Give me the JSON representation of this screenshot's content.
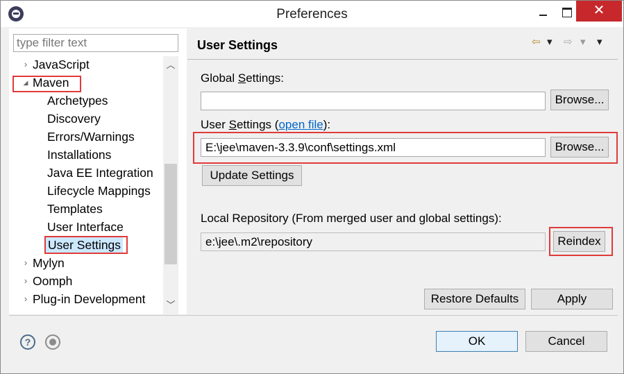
{
  "window": {
    "title": "Preferences",
    "close_glyph": "✕"
  },
  "filter": {
    "placeholder": "type filter text"
  },
  "tree": {
    "items": [
      {
        "label": "JavaScript",
        "arrow": "›"
      },
      {
        "label": "Maven",
        "arrow": "◢"
      },
      {
        "label": "Archetypes"
      },
      {
        "label": "Discovery"
      },
      {
        "label": "Errors/Warnings"
      },
      {
        "label": "Installations"
      },
      {
        "label": "Java EE Integration"
      },
      {
        "label": "Lifecycle Mappings"
      },
      {
        "label": "Templates"
      },
      {
        "label": "User Interface"
      },
      {
        "label": "User Settings"
      },
      {
        "label": "Mylyn",
        "arrow": "›"
      },
      {
        "label": "Oomph",
        "arrow": "›"
      },
      {
        "label": "Plug-in Development",
        "arrow": "›"
      }
    ],
    "scroll_up": "︿",
    "scroll_down": "﹀"
  },
  "page": {
    "title": "User Settings",
    "nav_back": "⇦",
    "nav_back_menu": "▾",
    "nav_fwd": "⇨",
    "nav_fwd_menu": "▾",
    "view_menu": "▾"
  },
  "global_settings": {
    "label_pre": "Global ",
    "label_u": "S",
    "label_post": "ettings:",
    "value": "",
    "browse": "Browse..."
  },
  "user_settings": {
    "label_pre": "User ",
    "label_u": "S",
    "label_post": "ettings (",
    "link": "open file",
    "label_end": "):",
    "value": "E:\\jee\\maven-3.3.9\\conf\\settings.xml",
    "browse": "Browse...",
    "update": "Update Settings"
  },
  "local_repo": {
    "label": "Local Repository (From merged user and global settings):",
    "value": "e:\\jee\\.m2\\repository",
    "reindex": "Reindex"
  },
  "buttons": {
    "restore": "Restore Defaults",
    "apply": "Apply",
    "ok": "OK",
    "cancel": "Cancel"
  },
  "footer": {
    "help": "?"
  },
  "colors": {
    "annotation_red": "#e03a3a",
    "selection": "#cce8ff",
    "link": "#0066cc",
    "close_button": "#c7282c"
  }
}
